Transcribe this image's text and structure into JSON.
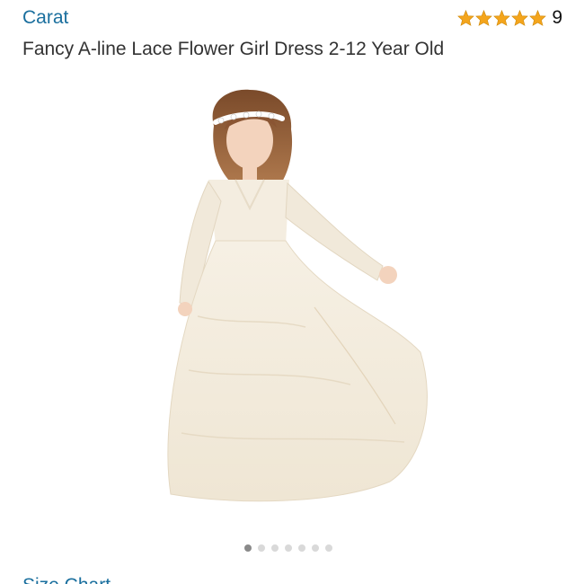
{
  "header": {
    "brand": "Carat",
    "rating_count": "9",
    "stars": 5
  },
  "product": {
    "title": "Fancy A-line Lace Flower Girl Dress 2-12 Year Old",
    "image_alt": "Flower girl in white lace dress"
  },
  "carousel": {
    "total": 7,
    "active": 1
  },
  "links": {
    "size_chart": "Size Chart"
  },
  "colors": {
    "link": "#1a6f9e",
    "star": "#f4a51c",
    "text": "#333333"
  },
  "icons": {
    "star": "star-icon"
  }
}
